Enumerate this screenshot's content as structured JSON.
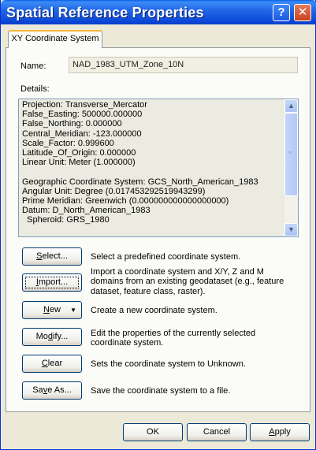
{
  "window": {
    "title": "Spatial Reference Properties",
    "help_glyph": "?",
    "close_glyph": "✕"
  },
  "tab": {
    "label": "XY Coordinate System"
  },
  "name": {
    "label": "Name:",
    "value": "NAD_1983_UTM_Zone_10N"
  },
  "details": {
    "label": "Details:",
    "text": "Projection: Transverse_Mercator\nFalse_Easting: 500000.000000\nFalse_Northing: 0.000000\nCentral_Meridian: -123.000000\nScale_Factor: 0.999600\nLatitude_Of_Origin: 0.000000\nLinear Unit: Meter (1.000000)\n\nGeographic Coordinate System: GCS_North_American_1983\nAngular Unit: Degree (0.017453292519943299)\nPrime Meridian: Greenwich (0.000000000000000000)\nDatum: D_North_American_1983\n  Spheroid: GRS_1980"
  },
  "actions": {
    "select": {
      "label_pre": "",
      "label_u": "S",
      "label_post": "elect...",
      "desc": "Select a predefined coordinate system."
    },
    "import": {
      "label_pre": "",
      "label_u": "I",
      "label_post": "mport...",
      "desc": "Import a coordinate system and X/Y, Z and M domains from an existing geodataset (e.g., feature dataset, feature class, raster)."
    },
    "new": {
      "label_pre": "",
      "label_u": "N",
      "label_post": "ew",
      "caret": "▼",
      "desc": "Create a new coordinate system."
    },
    "modify": {
      "label_pre": "Mo",
      "label_u": "d",
      "label_post": "ify...",
      "desc": "Edit the properties of the currently selected coordinate system."
    },
    "clear": {
      "label_pre": "",
      "label_u": "C",
      "label_post": "lear",
      "desc": "Sets the coordinate system to Unknown."
    },
    "save_as": {
      "label_pre": "Sa",
      "label_u": "v",
      "label_post": "e As...",
      "desc": "Save the coordinate system to a file."
    }
  },
  "footer": {
    "ok": "OK",
    "cancel": "Cancel",
    "apply_u": "A",
    "apply_post": "pply"
  },
  "scrollbar": {
    "up": "▲",
    "down": "▼",
    "grip": "≡"
  }
}
